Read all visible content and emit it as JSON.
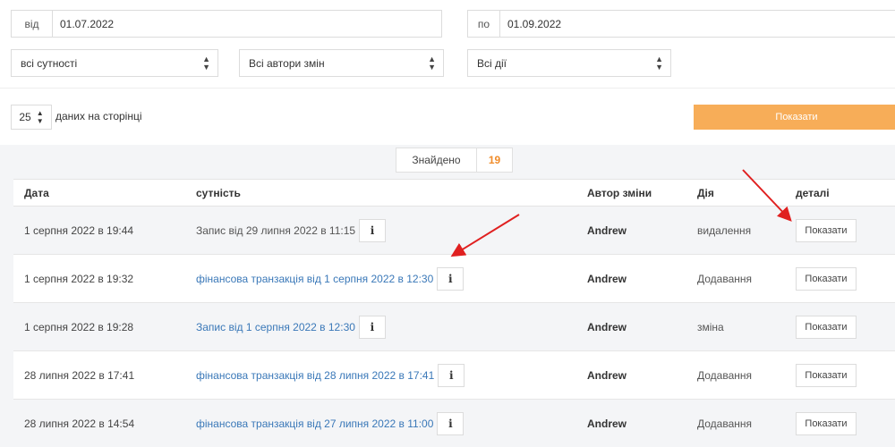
{
  "filters": {
    "date_from": {
      "prefix": "від",
      "value": "01.07.2022"
    },
    "date_to": {
      "prefix": "по",
      "value": "01.09.2022"
    },
    "entities_select": "всі сутності",
    "authors_select": "Всі автори змін",
    "actions_select": "Всі дії",
    "per_page": {
      "value": "25",
      "label": "даних на сторінці"
    },
    "show_button": "Показати"
  },
  "results": {
    "found_label": "Знайдено",
    "found_count": "19"
  },
  "table": {
    "headers": {
      "date": "Дата",
      "entity": "сутність",
      "author": "Автор зміни",
      "action": "Дія",
      "details": "деталі"
    },
    "rows": [
      {
        "date": "1 серпня 2022 в 19:44",
        "entity": "Запис від 29 липня 2022 в 11:15",
        "author": "Andrew",
        "action": "видалення",
        "details": "Показати"
      },
      {
        "date": "1 серпня 2022 в 19:32",
        "entity": "фінансова транзакція від 1 серпня 2022 в 12:30",
        "author": "Andrew",
        "action": "Додавання",
        "details": "Показати"
      },
      {
        "date": "1 серпня 2022 в 19:28",
        "entity": "Запис від 1 серпня 2022 в 12:30",
        "author": "Andrew",
        "action": "зміна",
        "details": "Показати"
      },
      {
        "date": "28 липня 2022 в 17:41",
        "entity": "фінансова транзакція від 28 липня 2022 в 17:41",
        "author": "Andrew",
        "action": "Додавання",
        "details": "Показати"
      },
      {
        "date": "28 липня 2022 в 14:54",
        "entity": "фінансова транзакція від 27 липня 2022 в 11:00",
        "author": "Andrew",
        "action": "Додавання",
        "details": "Показати"
      }
    ]
  },
  "icons": {
    "info": "i",
    "select_caret": "▲▼"
  },
  "colors": {
    "accent_button": "#f7ad58",
    "found_count": "#f08c2a",
    "link": "#3a78b8",
    "annotation_arrow": "#e02020"
  }
}
